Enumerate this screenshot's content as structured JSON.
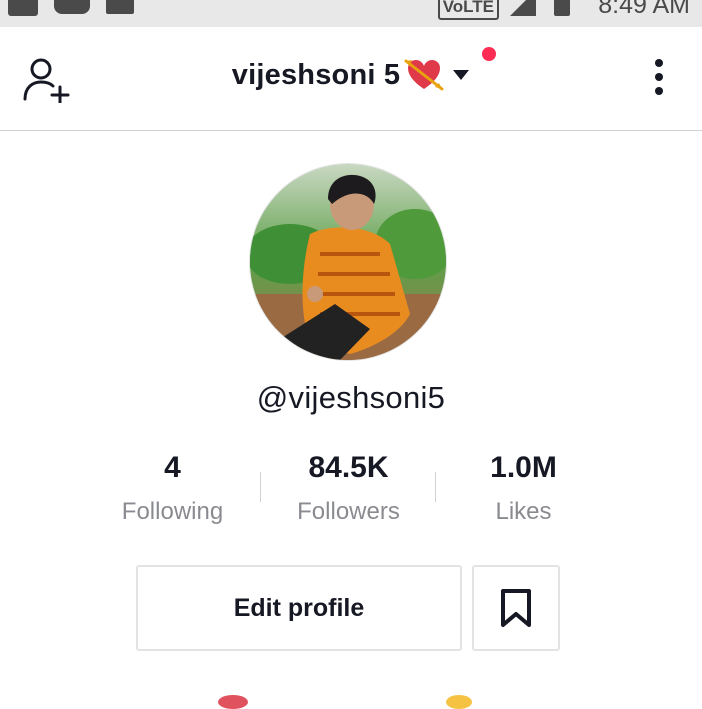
{
  "status_bar": {
    "volte_label": "VoLTE",
    "time": "8:49 AM",
    "icons": [
      "facebook-icon",
      "youtube-icon",
      "gallery-icon",
      "signal-icon",
      "battery-icon"
    ]
  },
  "header": {
    "title": "vijeshsoni 5",
    "title_emoji": "heart-with-arrow",
    "add_user_icon": "add-user-icon",
    "more_icon": "more-vertical-icon",
    "notification_color": "#fe2c55"
  },
  "profile": {
    "handle": "@vijeshsoni5",
    "stats": [
      {
        "value": "4",
        "label": "Following"
      },
      {
        "value": "84.5K",
        "label": "Followers"
      },
      {
        "value": "1.0M",
        "label": "Likes"
      }
    ],
    "edit_label": "Edit profile",
    "bookmark_icon": "bookmark-icon"
  },
  "colors": {
    "text": "#161823",
    "muted": "#8a8b91",
    "border": "#e3e3e4",
    "accent": "#fe2c55"
  }
}
